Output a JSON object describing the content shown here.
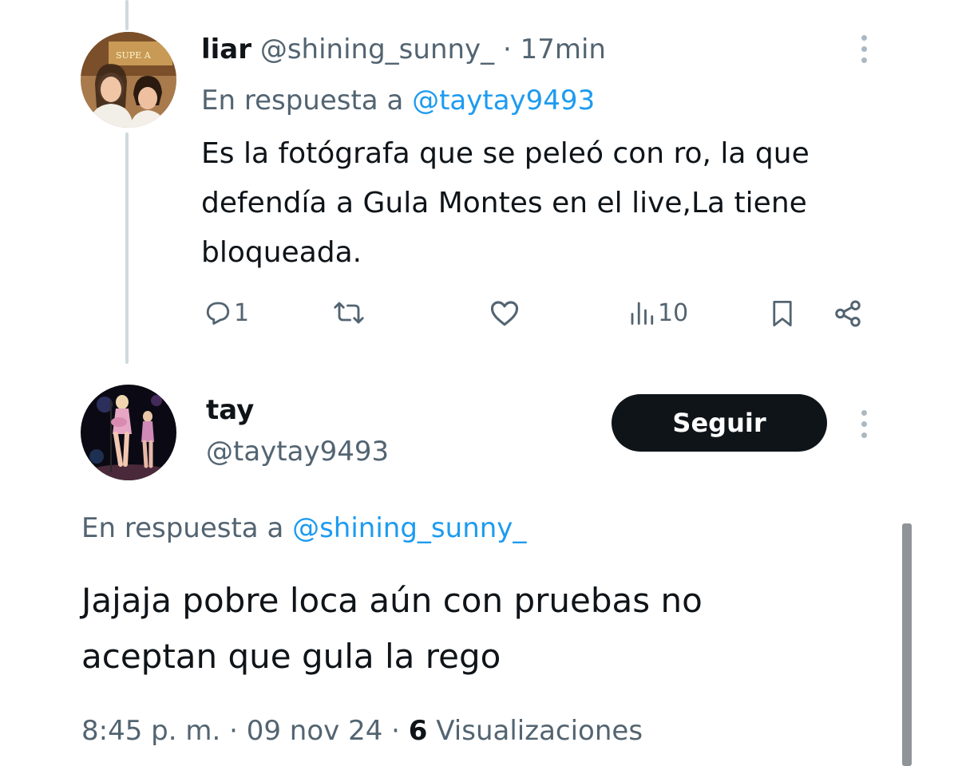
{
  "reply_tweet": {
    "display_name": "liar",
    "handle": "@shining_sunny_",
    "time": "· 17min",
    "reply_prefix": "En respuesta a",
    "reply_to": "@taytay9493",
    "text_lines": [
      "Es la fotógrafa que se peleó con ro, la que",
      "defendía a Gula Montes en el live,La tiene",
      "bloqueada."
    ],
    "actions": {
      "replies": "1",
      "reposts": "",
      "likes": "",
      "views": "10"
    },
    "avatar_sign_text": "SUPE A"
  },
  "main_tweet": {
    "display_name": "tay",
    "handle": "@taytay9493",
    "follow_label": "Seguir",
    "reply_prefix": "En respuesta a",
    "reply_to": "@shining_sunny_",
    "text_lines": [
      "Jajaja pobre loca aún con pruebas no",
      "aceptan que gula la rego"
    ],
    "timestamp_time": "8:45 p. m.",
    "timestamp_date": "09 nov 24",
    "views_count": "6",
    "views_label": "Visualizaciones"
  },
  "colors": {
    "link": "#1d9bf0",
    "secondary_text": "#536471",
    "primary_text": "#0f1419",
    "thread_line": "#cfd9de"
  },
  "icons": [
    "reply-icon",
    "repost-icon",
    "like-icon",
    "views-icon",
    "bookmark-icon",
    "share-icon",
    "more-icon"
  ]
}
